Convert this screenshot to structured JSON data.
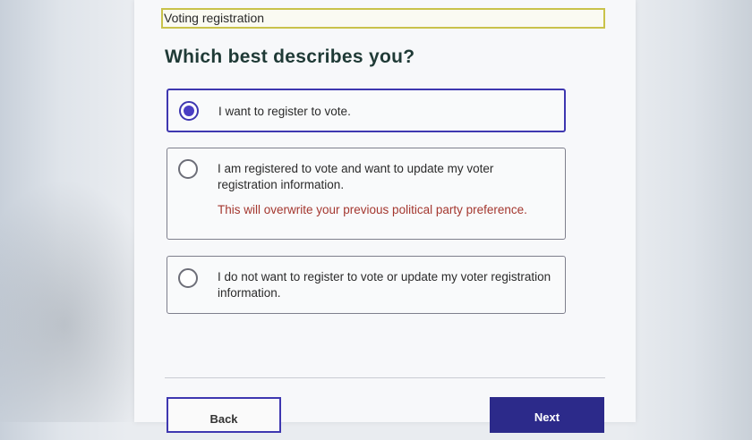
{
  "breadcrumb": "Voting registration",
  "heading": "Which best describes you?",
  "options": [
    {
      "label": "I want to register to vote.",
      "selected": true
    },
    {
      "label": "I am registered to vote and want to update my voter registration information.",
      "warning": "This will overwrite your previous political party preference.",
      "selected": false
    },
    {
      "label": "I do not want to register to vote or update my voter registration information.",
      "selected": false
    }
  ],
  "buttons": {
    "back": "Back",
    "next": "Next"
  },
  "colors": {
    "accent": "#3e37b0",
    "primary_button": "#2c2a8a",
    "warning": "#a4372f",
    "breadcrumb_border": "#c9c24a"
  }
}
